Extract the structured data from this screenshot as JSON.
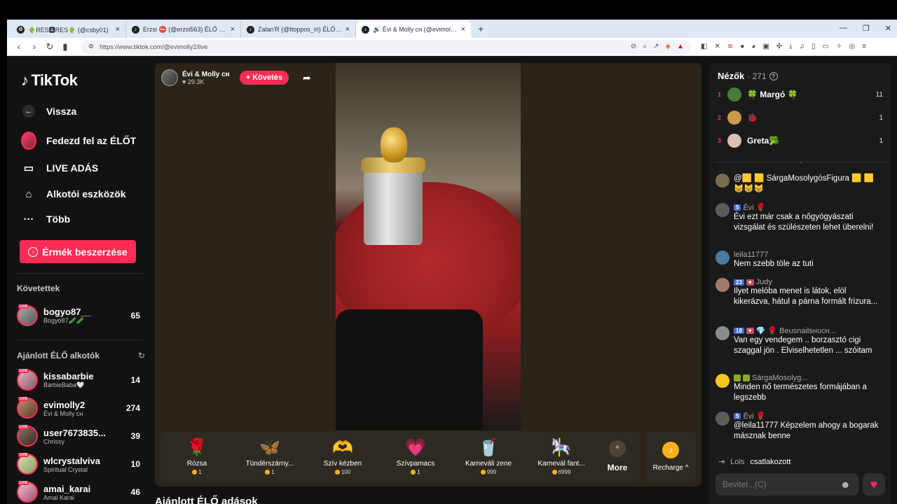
{
  "browser": {
    "tabs": [
      {
        "icon": "❂",
        "title": "🌵RES🅰RES🌵 (@csby01)"
      },
      {
        "icon": "♪",
        "title": "Erzsi ⛔ (@erzsi563) ÉLŐ adásban van"
      },
      {
        "icon": "♪",
        "title": "Zalan'R (@ttoppos_irl) ÉLŐ adás"
      },
      {
        "icon": "♪",
        "title": "🔊 Évi & Molly ᴄʜ (@evimolly2)"
      }
    ],
    "url": "https://www.tiktok.com/@evimolly2/live"
  },
  "sidebar": {
    "logo": "TikTok",
    "back": "Vissza",
    "nav": [
      "Fedezd fel az ÉLŐT",
      "LIVE ADÁS",
      "Alkotói eszközök",
      "Több"
    ],
    "coins_button": "Érmék beszerzése",
    "followed_title": "Követettek",
    "followed": [
      {
        "name": "bogyo87__",
        "sub": "Bogyó87🥒🥒",
        "count": "65"
      }
    ],
    "recommended_title": "Ajánlott ÉLŐ alkotók",
    "recommended": [
      {
        "name": "kissabarbie",
        "sub": "BarbieBaba🤍",
        "count": "14"
      },
      {
        "name": "evimolly2",
        "sub": "Évi & Molly ᴄʜ",
        "count": "274"
      },
      {
        "name": "user7673835...",
        "sub": "Chrissy",
        "count": "39"
      },
      {
        "name": "wlcrystalviva",
        "sub": "Spiritual Crystal",
        "count": "10"
      },
      {
        "name": "amai_karai",
        "sub": "Amai Karai",
        "count": "46"
      }
    ],
    "live_badge": "LIVE"
  },
  "stream": {
    "host_name": "Évi & Molly ᴄʜ",
    "host_likes": "♥ 29.3K",
    "follow_label": "+ Követés",
    "gifts": [
      {
        "icon": "🌹",
        "name": "Rózsa",
        "price": "1"
      },
      {
        "icon": "🦋",
        "name": "Tündérszárny...",
        "price": "1"
      },
      {
        "icon": "🫶",
        "name": "Szív kézben",
        "price": "100"
      },
      {
        "icon": "💗",
        "name": "Szívpamacs",
        "price": "1"
      },
      {
        "icon": "🥤",
        "name": "Karneváli zene",
        "price": "999"
      },
      {
        "icon": "🎠",
        "name": "Karnevál fant...",
        "price": "6999"
      }
    ],
    "more_label": "More",
    "recharge_label": "Recharge ^"
  },
  "recommended_heading": "Ajánlott ÉLŐ adások",
  "panel": {
    "viewers_title": "Nézők",
    "viewers_count": "· 271",
    "top_viewers": [
      {
        "rank": "1",
        "name": "🍀 Margó 🍀",
        "score": "11",
        "color": "#4a7a3a"
      },
      {
        "rank": "2",
        "name": "🐞",
        "score": "1",
        "color": "#c99a4a"
      },
      {
        "rank": "3",
        "name": "Greta🥦",
        "score": "1",
        "color": "#d9c0b0"
      }
    ],
    "messages": [
      {
        "user": "",
        "badge": "",
        "heart": "",
        "text": "@🟨 🟨 SárgaMosolygósFigura 🟨 🟨 😸😸😸",
        "av": "#7a6a50"
      },
      {
        "user": "Évi 🌹",
        "badge": "5",
        "heart": "",
        "text": "Évi ezt már csak a nőgyógyászati vizsgálat és szülészeten lehet überelni!",
        "av": "#5c5c5c"
      },
      {
        "user": "leila11777",
        "badge": "",
        "heart": "",
        "text": "Nem szebb töle az tuti",
        "av": "#4a7aa0"
      },
      {
        "user": "Judy",
        "badge": "23",
        "heart": "♥",
        "text": "Ilyet melóba menet is látok, elöl kikerázva, hátul a párna formált frizura...",
        "av": "#a07a6a"
      },
      {
        "user": "💎 🌹 Beusnailsʜᴜᴄʜ...",
        "badge": "18",
        "heart": "♥",
        "text": "Van egy vendegem .. borzasztó cigi szaggal jön . Elviselhetetlen ... szóitam",
        "av": "#8a8a8a"
      },
      {
        "user": "SárgaMosolyg...",
        "badge": "",
        "heart": "",
        "text": "Minden nő természetes formájában a legszebb",
        "av": "#f7c51d"
      },
      {
        "user": "Évi 🌹",
        "badge": "5",
        "heart": "",
        "text": "@leila11777 Képzelem ahogy a bogarak másznak benne",
        "av": "#5c5c5c"
      }
    ],
    "joined_user": "Lols",
    "joined_text": "csatlakozott",
    "input_placeholder": "Bevitel...(C)"
  }
}
